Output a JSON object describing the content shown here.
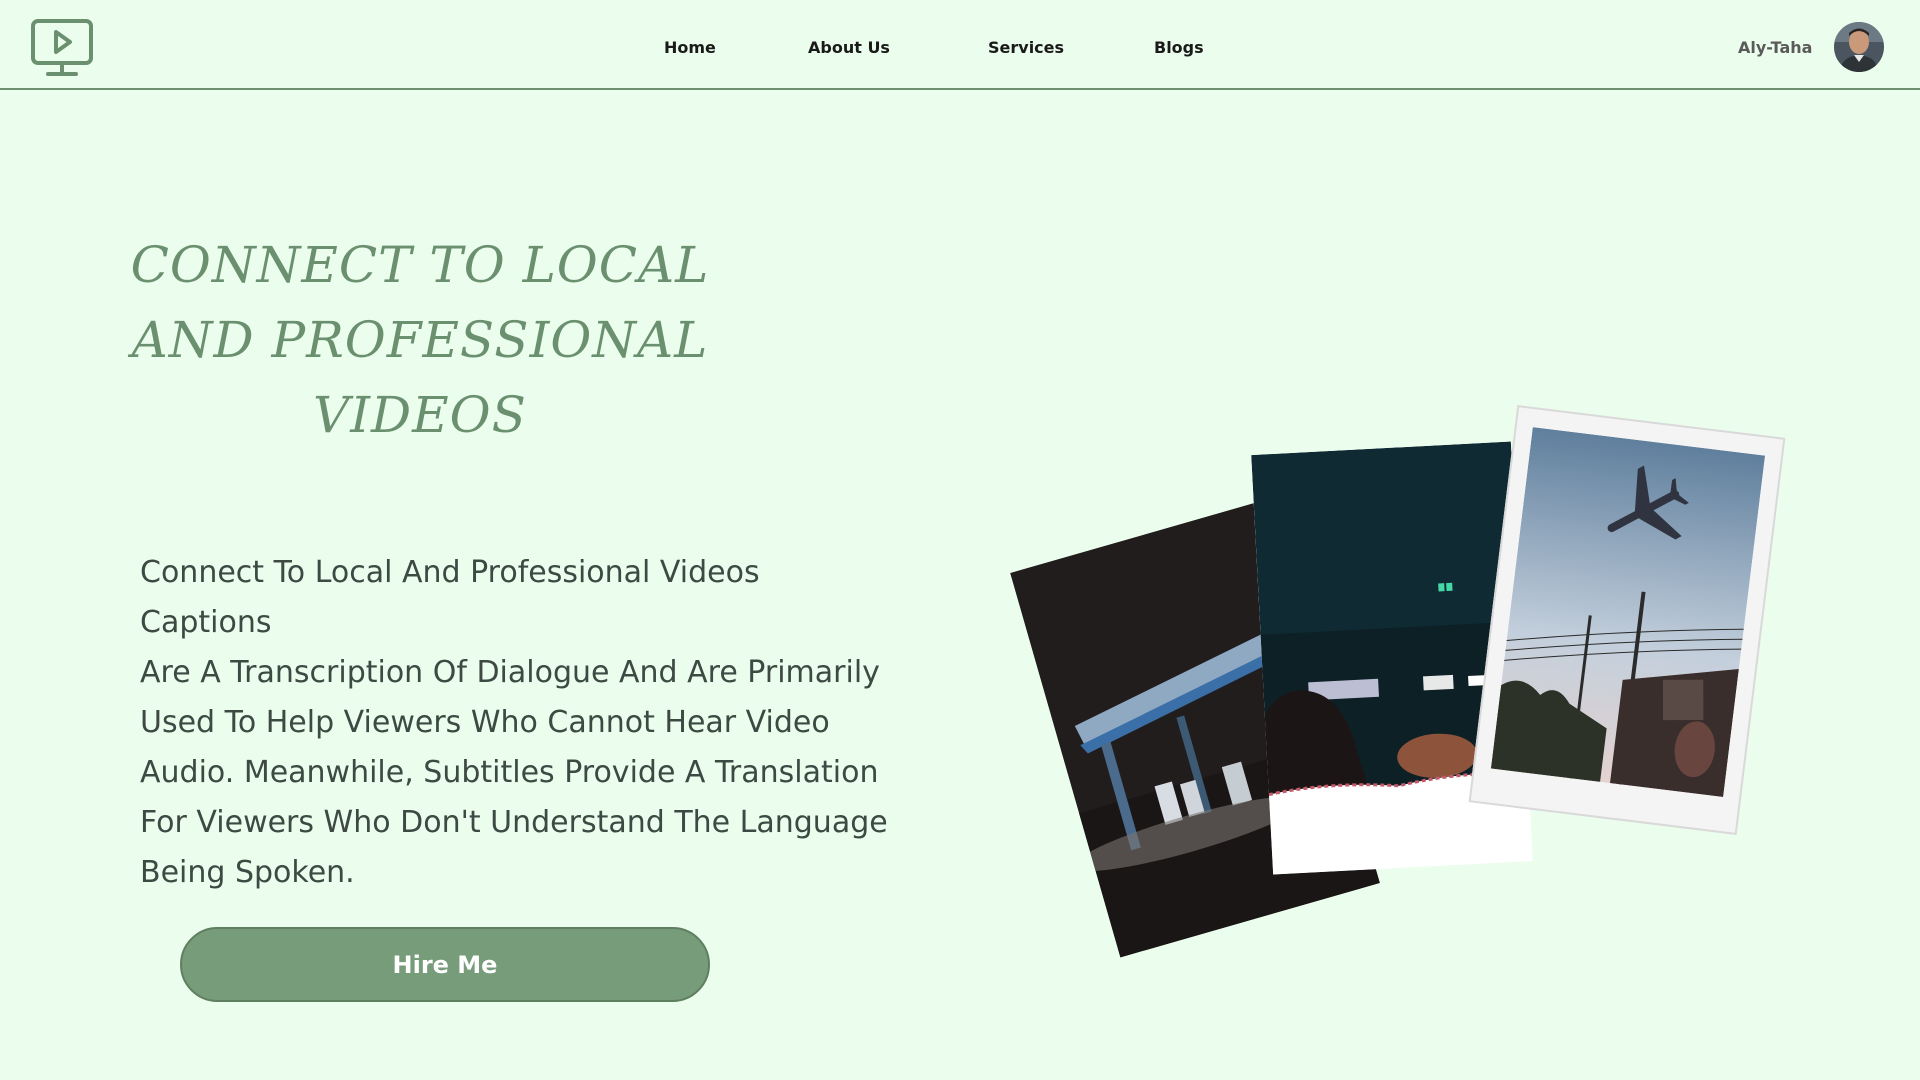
{
  "header": {
    "logo_icon": "monitor-play-icon",
    "nav": {
      "home": "Home",
      "about": "About Us",
      "services": "Services",
      "blogs": "Blogs"
    },
    "user": {
      "name": "Aly-Taha",
      "avatar_icon": "user-avatar"
    }
  },
  "hero": {
    "title_line1": "CONNECT TO LOCAL",
    "title_line2": "AND PROFESSIONAL",
    "title_line3": "VIDEOS",
    "description_lines": [
      "Connect To Local And Professional Videos Captions",
      "Are A Transcription Of Dialogue And Are Primarily",
      "Used To Help Viewers Who Cannot Hear Video",
      "Audio. Meanwhile, Subtitles Provide A Translation",
      "For Viewers Who Don't Understand The Language",
      "Being Spoken."
    ],
    "cta_label": "Hire Me"
  },
  "gallery": {
    "photos": [
      "gas-station-photo",
      "night-street-photo",
      "airplane-photo"
    ]
  },
  "colors": {
    "background": "#ebfdec",
    "accent": "#779c79",
    "title": "#6b9070",
    "text": "#3d4a44"
  }
}
